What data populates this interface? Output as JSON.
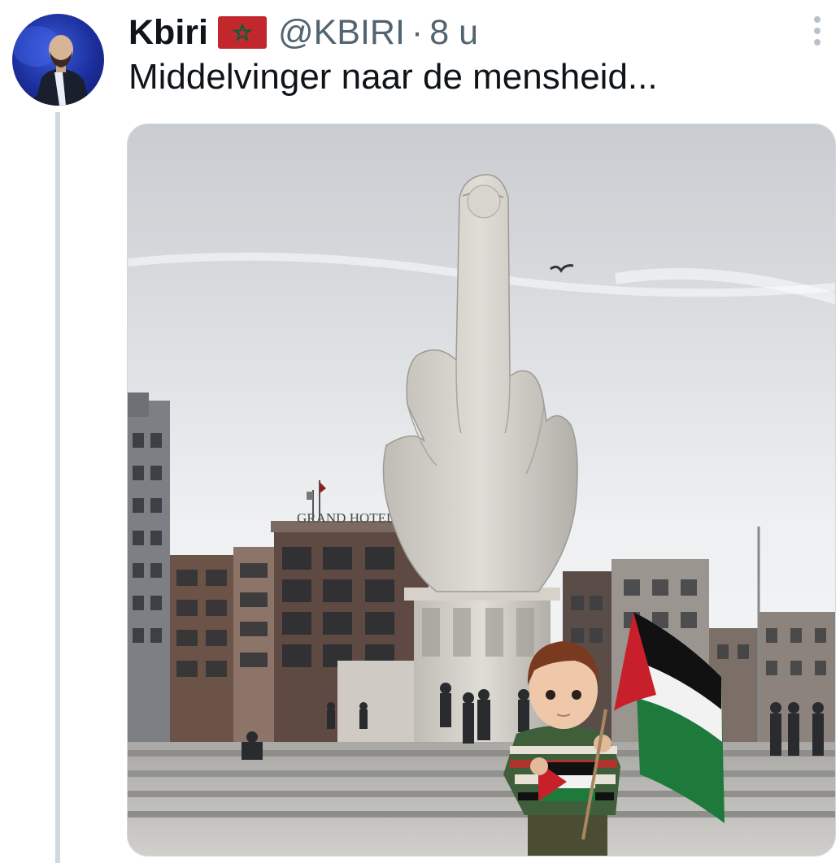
{
  "tweet": {
    "author_name": "Kbiri",
    "author_flag": "morocco-flag-icon",
    "handle": "@KBIRI",
    "separator": "·",
    "time": "8 u",
    "text": "Middelvinger naar de mensheid...",
    "avatar": "profile-photo",
    "image": {
      "hotel_sign": "GRAND HOTEL K",
      "description_icon": "photo"
    }
  },
  "colors": {
    "text_primary": "#0f1419",
    "text_secondary": "#536471",
    "thread_line": "#cfd9de",
    "flag_red": "#c1272d",
    "flag_green": "#006233"
  }
}
